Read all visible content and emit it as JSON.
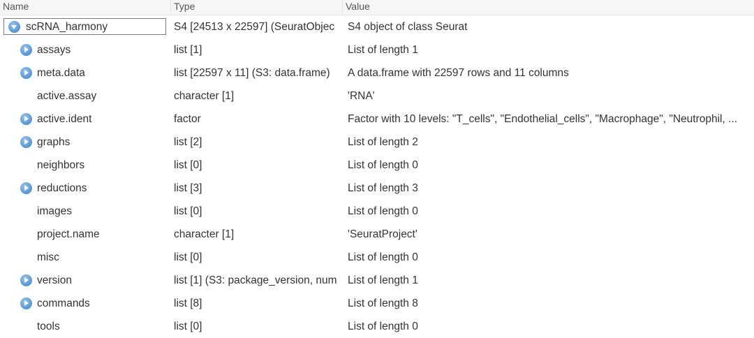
{
  "columns": {
    "name": "Name",
    "type": "Type",
    "value": "Value"
  },
  "colors": {
    "expand_icon": "#5f9fda",
    "header_bg": "#f6f6f6"
  },
  "root": {
    "name": "scRNA_harmony",
    "type": "S4 [24513 x 22597] (SeuratObjec",
    "value": "S4 object of class Seurat",
    "icon": "collapse-circle-icon"
  },
  "rows": [
    {
      "name": "assays",
      "type": "list [1]",
      "value": "List of length 1",
      "expandable": true
    },
    {
      "name": "meta.data",
      "type": "list [22597 x 11] (S3: data.frame)",
      "value": "A data.frame with 22597 rows and 11 columns",
      "expandable": true
    },
    {
      "name": "active.assay",
      "type": "character [1]",
      "value": "'RNA'",
      "expandable": false
    },
    {
      "name": "active.ident",
      "type": "factor",
      "value": "Factor with 10 levels: \"T_cells\", \"Endothelial_cells\", \"Macrophage\", \"Neutrophil, ...",
      "expandable": true
    },
    {
      "name": "graphs",
      "type": "list [2]",
      "value": "List of length 2",
      "expandable": true
    },
    {
      "name": "neighbors",
      "type": "list [0]",
      "value": "List of length 0",
      "expandable": false
    },
    {
      "name": "reductions",
      "type": "list [3]",
      "value": "List of length 3",
      "expandable": true
    },
    {
      "name": "images",
      "type": "list [0]",
      "value": "List of length 0",
      "expandable": false
    },
    {
      "name": "project.name",
      "type": "character [1]",
      "value": "'SeuratProject'",
      "expandable": false
    },
    {
      "name": "misc",
      "type": "list [0]",
      "value": "List of length 0",
      "expandable": false
    },
    {
      "name": "version",
      "type": "list [1] (S3: package_version, num",
      "value": "List of length 1",
      "expandable": true
    },
    {
      "name": "commands",
      "type": "list [8]",
      "value": "List of length 8",
      "expandable": true
    },
    {
      "name": "tools",
      "type": "list [0]",
      "value": "List of length 0",
      "expandable": false
    }
  ]
}
